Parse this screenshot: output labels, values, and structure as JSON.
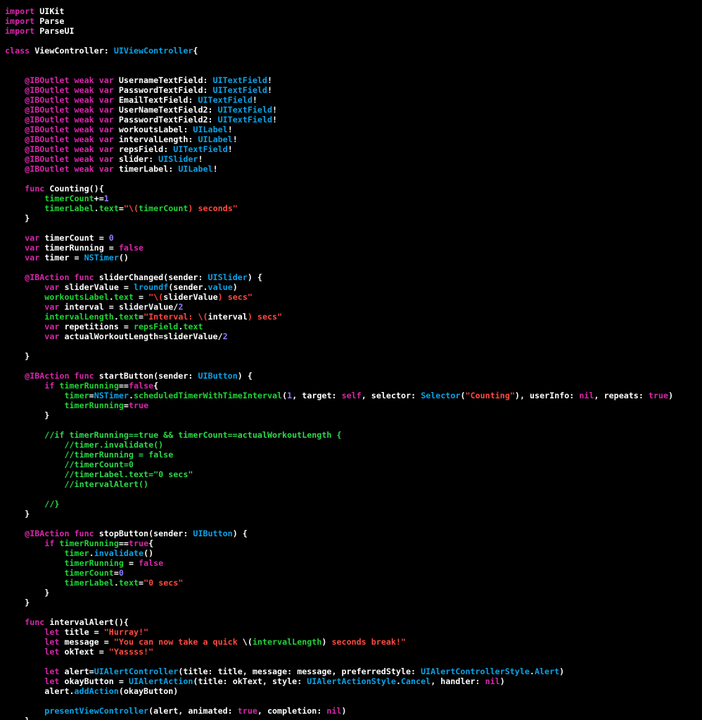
{
  "colors": {
    "background": "#000000",
    "plain": "#ffffff",
    "keyword": "#d926ab",
    "type": "#0aa3e8",
    "property": "#1fd637",
    "string": "#ff4a40",
    "number": "#8d7dff",
    "comment": "#2bd94a"
  },
  "editor": {
    "lines": [
      [
        [
          "keyword",
          "import"
        ],
        [
          "plain",
          " UIKit"
        ]
      ],
      [
        [
          "keyword",
          "import"
        ],
        [
          "plain",
          " Parse"
        ]
      ],
      [
        [
          "keyword",
          "import"
        ],
        [
          "plain",
          " ParseUI"
        ]
      ],
      [],
      [
        [
          "keyword",
          "class"
        ],
        [
          "plain",
          " ViewController: "
        ],
        [
          "type",
          "UIViewController"
        ],
        [
          "plain",
          "{"
        ]
      ],
      [],
      [],
      [
        [
          "plain",
          "    "
        ],
        [
          "keyword",
          "@IBOutlet weak var"
        ],
        [
          "plain",
          " UsernameTextField: "
        ],
        [
          "type",
          "UITextField"
        ],
        [
          "plain",
          "!"
        ]
      ],
      [
        [
          "plain",
          "    "
        ],
        [
          "keyword",
          "@IBOutlet weak var"
        ],
        [
          "plain",
          " PasswordTextField: "
        ],
        [
          "type",
          "UITextField"
        ],
        [
          "plain",
          "!"
        ]
      ],
      [
        [
          "plain",
          "    "
        ],
        [
          "keyword",
          "@IBOutlet weak var"
        ],
        [
          "plain",
          " EmailTextField: "
        ],
        [
          "type",
          "UITextField"
        ],
        [
          "plain",
          "!"
        ]
      ],
      [
        [
          "plain",
          "    "
        ],
        [
          "keyword",
          "@IBOutlet weak var"
        ],
        [
          "plain",
          " UserNameTextField2: "
        ],
        [
          "type",
          "UITextField"
        ],
        [
          "plain",
          "!"
        ]
      ],
      [
        [
          "plain",
          "    "
        ],
        [
          "keyword",
          "@IBOutlet weak var"
        ],
        [
          "plain",
          " PasswordTextField2: "
        ],
        [
          "type",
          "UITextField"
        ],
        [
          "plain",
          "!"
        ]
      ],
      [
        [
          "plain",
          "    "
        ],
        [
          "keyword",
          "@IBOutlet weak var"
        ],
        [
          "plain",
          " workoutsLabel: "
        ],
        [
          "type",
          "UILabel"
        ],
        [
          "plain",
          "!"
        ]
      ],
      [
        [
          "plain",
          "    "
        ],
        [
          "keyword",
          "@IBOutlet weak var"
        ],
        [
          "plain",
          " intervalLength: "
        ],
        [
          "type",
          "UILabel"
        ],
        [
          "plain",
          "!"
        ]
      ],
      [
        [
          "plain",
          "    "
        ],
        [
          "keyword",
          "@IBOutlet weak var"
        ],
        [
          "plain",
          " repsField: "
        ],
        [
          "type",
          "UITextField"
        ],
        [
          "plain",
          "!"
        ]
      ],
      [
        [
          "plain",
          "    "
        ],
        [
          "keyword",
          "@IBOutlet weak var"
        ],
        [
          "plain",
          " slider: "
        ],
        [
          "type",
          "UISlider"
        ],
        [
          "plain",
          "!"
        ]
      ],
      [
        [
          "plain",
          "    "
        ],
        [
          "keyword",
          "@IBOutlet weak var"
        ],
        [
          "plain",
          " timerLabel: "
        ],
        [
          "type",
          "UILabel"
        ],
        [
          "plain",
          "!"
        ]
      ],
      [],
      [
        [
          "plain",
          "    "
        ],
        [
          "keyword",
          "func"
        ],
        [
          "plain",
          " Counting(){"
        ]
      ],
      [
        [
          "plain",
          "        "
        ],
        [
          "property",
          "timerCount"
        ],
        [
          "plain",
          "+="
        ],
        [
          "number",
          "1"
        ]
      ],
      [
        [
          "plain",
          "        "
        ],
        [
          "property",
          "timerLabel"
        ],
        [
          "plain",
          "."
        ],
        [
          "property",
          "text"
        ],
        [
          "plain",
          "="
        ],
        [
          "string",
          "\"\\("
        ],
        [
          "property",
          "timerCount"
        ],
        [
          "string",
          ") seconds\""
        ]
      ],
      [
        [
          "plain",
          "    }"
        ]
      ],
      [],
      [
        [
          "plain",
          "    "
        ],
        [
          "keyword",
          "var"
        ],
        [
          "plain",
          " timerCount = "
        ],
        [
          "number",
          "0"
        ]
      ],
      [
        [
          "plain",
          "    "
        ],
        [
          "keyword",
          "var"
        ],
        [
          "plain",
          " timerRunning = "
        ],
        [
          "keyword",
          "false"
        ]
      ],
      [
        [
          "plain",
          "    "
        ],
        [
          "keyword",
          "var"
        ],
        [
          "plain",
          " timer = "
        ],
        [
          "type",
          "NSTimer"
        ],
        [
          "plain",
          "()"
        ]
      ],
      [],
      [
        [
          "plain",
          "    "
        ],
        [
          "keyword",
          "@IBAction func"
        ],
        [
          "plain",
          " sliderChanged(sender: "
        ],
        [
          "type",
          "UISlider"
        ],
        [
          "plain",
          ") {"
        ]
      ],
      [
        [
          "plain",
          "        "
        ],
        [
          "keyword",
          "var"
        ],
        [
          "plain",
          " sliderValue = "
        ],
        [
          "type",
          "lroundf"
        ],
        [
          "plain",
          "(sender."
        ],
        [
          "type",
          "value"
        ],
        [
          "plain",
          ")"
        ]
      ],
      [
        [
          "plain",
          "        "
        ],
        [
          "property",
          "workoutsLabel"
        ],
        [
          "plain",
          "."
        ],
        [
          "property",
          "text"
        ],
        [
          "plain",
          " = "
        ],
        [
          "string",
          "\"\\("
        ],
        [
          "plain",
          "sliderValue"
        ],
        [
          "string",
          ") secs\""
        ]
      ],
      [
        [
          "plain",
          "        "
        ],
        [
          "keyword",
          "var"
        ],
        [
          "plain",
          " interval = sliderValue/"
        ],
        [
          "number",
          "2"
        ]
      ],
      [
        [
          "plain",
          "        "
        ],
        [
          "property",
          "intervalLength"
        ],
        [
          "plain",
          "."
        ],
        [
          "property",
          "text"
        ],
        [
          "plain",
          "="
        ],
        [
          "string",
          "\"Interval: \\("
        ],
        [
          "plain",
          "interval"
        ],
        [
          "string",
          ") secs\""
        ]
      ],
      [
        [
          "plain",
          "        "
        ],
        [
          "keyword",
          "var"
        ],
        [
          "plain",
          " repetitions = "
        ],
        [
          "property",
          "repsField"
        ],
        [
          "plain",
          "."
        ],
        [
          "property",
          "text"
        ]
      ],
      [
        [
          "plain",
          "        "
        ],
        [
          "keyword",
          "var"
        ],
        [
          "plain",
          " actualWorkoutLength=sliderValue/"
        ],
        [
          "number",
          "2"
        ]
      ],
      [],
      [
        [
          "plain",
          "    }"
        ]
      ],
      [],
      [
        [
          "plain",
          "    "
        ],
        [
          "keyword",
          "@IBAction func"
        ],
        [
          "plain",
          " startButton(sender: "
        ],
        [
          "type",
          "UIButton"
        ],
        [
          "plain",
          ") {"
        ]
      ],
      [
        [
          "plain",
          "        "
        ],
        [
          "keyword",
          "if"
        ],
        [
          "plain",
          " "
        ],
        [
          "property",
          "timerRunning"
        ],
        [
          "plain",
          "=="
        ],
        [
          "keyword",
          "false"
        ],
        [
          "plain",
          "{"
        ]
      ],
      [
        [
          "plain",
          "            "
        ],
        [
          "property",
          "timer"
        ],
        [
          "plain",
          "="
        ],
        [
          "type",
          "NSTimer"
        ],
        [
          "plain",
          "."
        ],
        [
          "property",
          "scheduledTimerWithTimeInterval"
        ],
        [
          "plain",
          "("
        ],
        [
          "number",
          "1"
        ],
        [
          "plain",
          ", target: "
        ],
        [
          "keyword",
          "self"
        ],
        [
          "plain",
          ", selector: "
        ],
        [
          "type",
          "Selector"
        ],
        [
          "plain",
          "("
        ],
        [
          "string",
          "\"Counting\""
        ],
        [
          "plain",
          "), userInfo: "
        ],
        [
          "keyword",
          "nil"
        ],
        [
          "plain",
          ", repeats: "
        ],
        [
          "keyword",
          "true"
        ],
        [
          "plain",
          ")"
        ]
      ],
      [
        [
          "plain",
          "            "
        ],
        [
          "property",
          "timerRunning"
        ],
        [
          "plain",
          "="
        ],
        [
          "keyword",
          "true"
        ]
      ],
      [
        [
          "plain",
          "        }"
        ]
      ],
      [],
      [
        [
          "plain",
          "        "
        ],
        [
          "comment",
          "//if timerRunning==true && timerCount==actualWorkoutLength {"
        ]
      ],
      [
        [
          "plain",
          "            "
        ],
        [
          "comment",
          "//timer.invalidate()"
        ]
      ],
      [
        [
          "plain",
          "            "
        ],
        [
          "comment",
          "//timerRunning = false"
        ]
      ],
      [
        [
          "plain",
          "            "
        ],
        [
          "comment",
          "//timerCount=0"
        ]
      ],
      [
        [
          "plain",
          "            "
        ],
        [
          "comment",
          "//timerLabel.text=\"0 secs\""
        ]
      ],
      [
        [
          "plain",
          "            "
        ],
        [
          "comment",
          "//intervalAlert()"
        ]
      ],
      [],
      [
        [
          "plain",
          "        "
        ],
        [
          "comment",
          "//}"
        ]
      ],
      [
        [
          "plain",
          "    }"
        ]
      ],
      [],
      [
        [
          "plain",
          "    "
        ],
        [
          "keyword",
          "@IBAction func"
        ],
        [
          "plain",
          " stopButton(sender: "
        ],
        [
          "type",
          "UIButton"
        ],
        [
          "plain",
          ") {"
        ]
      ],
      [
        [
          "plain",
          "        "
        ],
        [
          "keyword",
          "if"
        ],
        [
          "plain",
          " "
        ],
        [
          "property",
          "timerRunning"
        ],
        [
          "plain",
          "=="
        ],
        [
          "keyword",
          "true"
        ],
        [
          "plain",
          "{"
        ]
      ],
      [
        [
          "plain",
          "            "
        ],
        [
          "property",
          "timer"
        ],
        [
          "plain",
          "."
        ],
        [
          "type",
          "invalidate"
        ],
        [
          "plain",
          "()"
        ]
      ],
      [
        [
          "plain",
          "            "
        ],
        [
          "property",
          "timerRunning"
        ],
        [
          "plain",
          " = "
        ],
        [
          "keyword",
          "false"
        ]
      ],
      [
        [
          "plain",
          "            "
        ],
        [
          "property",
          "timerCount"
        ],
        [
          "plain",
          "="
        ],
        [
          "number",
          "0"
        ]
      ],
      [
        [
          "plain",
          "            "
        ],
        [
          "property",
          "timerLabel"
        ],
        [
          "plain",
          "."
        ],
        [
          "property",
          "text"
        ],
        [
          "plain",
          "="
        ],
        [
          "string",
          "\"0 secs\""
        ]
      ],
      [
        [
          "plain",
          "        }"
        ]
      ],
      [
        [
          "plain",
          "    }"
        ]
      ],
      [],
      [
        [
          "plain",
          "    "
        ],
        [
          "keyword",
          "func"
        ],
        [
          "plain",
          " intervalAlert(){"
        ]
      ],
      [
        [
          "plain",
          "        "
        ],
        [
          "keyword",
          "let"
        ],
        [
          "plain",
          " title = "
        ],
        [
          "string",
          "\"Hurray!\""
        ]
      ],
      [
        [
          "plain",
          "        "
        ],
        [
          "keyword",
          "let"
        ],
        [
          "plain",
          " message = "
        ],
        [
          "string",
          "\"You can now take a quick "
        ],
        [
          "plain",
          "\\("
        ],
        [
          "property",
          "intervalLength"
        ],
        [
          "plain",
          ")"
        ],
        [
          "string",
          " seconds break!\""
        ]
      ],
      [
        [
          "plain",
          "        "
        ],
        [
          "keyword",
          "let"
        ],
        [
          "plain",
          " okText = "
        ],
        [
          "string",
          "\"Yassss!\""
        ]
      ],
      [],
      [
        [
          "plain",
          "        "
        ],
        [
          "keyword",
          "let"
        ],
        [
          "plain",
          " alert="
        ],
        [
          "type",
          "UIAlertController"
        ],
        [
          "plain",
          "(title: title, message: message, preferredStyle: "
        ],
        [
          "type",
          "UIAlertControllerStyle"
        ],
        [
          "plain",
          "."
        ],
        [
          "type",
          "Alert"
        ],
        [
          "plain",
          ")"
        ]
      ],
      [
        [
          "plain",
          "        "
        ],
        [
          "keyword",
          "let"
        ],
        [
          "plain",
          " okayButton = "
        ],
        [
          "type",
          "UIAlertAction"
        ],
        [
          "plain",
          "(title: okText, style: "
        ],
        [
          "type",
          "UIAlertActionStyle"
        ],
        [
          "plain",
          "."
        ],
        [
          "type",
          "Cancel"
        ],
        [
          "plain",
          ", handler: "
        ],
        [
          "keyword",
          "nil"
        ],
        [
          "plain",
          ")"
        ]
      ],
      [
        [
          "plain",
          "        alert."
        ],
        [
          "type",
          "addAction"
        ],
        [
          "plain",
          "(okayButton)"
        ]
      ],
      [],
      [
        [
          "plain",
          "        "
        ],
        [
          "type",
          "presentViewController"
        ],
        [
          "plain",
          "(alert, animated: "
        ],
        [
          "keyword",
          "true"
        ],
        [
          "plain",
          ", completion: "
        ],
        [
          "keyword",
          "nil"
        ],
        [
          "plain",
          ")"
        ]
      ],
      [
        [
          "plain",
          "    }"
        ]
      ]
    ]
  }
}
